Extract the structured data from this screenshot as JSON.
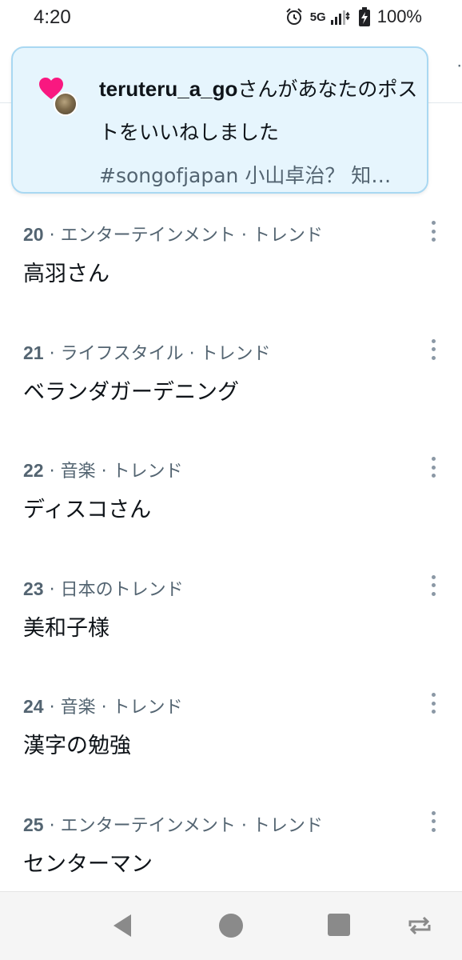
{
  "status_bar": {
    "time": "4:20",
    "network": "5G",
    "battery": "100%",
    "icons": [
      "alarm-icon",
      "signal-icon",
      "battery-icon"
    ]
  },
  "notification": {
    "username": "teruteru_a_go",
    "action": "さんがあなたのポストをいいねしました",
    "preview": "#songofjapan 小山卓治？ 知…",
    "icon": "heart-icon",
    "accent": "#f91880"
  },
  "trends": [
    {
      "rank": "20",
      "category": "· エンターテインメント · トレンド",
      "title": "高羽さん"
    },
    {
      "rank": "21",
      "category": "· ライフスタイル · トレンド",
      "title": "ベランダガーデニング"
    },
    {
      "rank": "22",
      "category": "· 音楽 · トレンド",
      "title": "ディスコさん"
    },
    {
      "rank": "23",
      "category": "· 日本のトレンド",
      "title": "美和子様"
    },
    {
      "rank": "24",
      "category": "· 音楽 · トレンド",
      "title": "漢字の勉強"
    },
    {
      "rank": "25",
      "category": "· エンターテインメント · トレンド",
      "title": "センターマン"
    }
  ],
  "nav_bar": {
    "buttons": [
      "back-icon",
      "home-icon",
      "recents-icon",
      "rotate-icon"
    ]
  }
}
